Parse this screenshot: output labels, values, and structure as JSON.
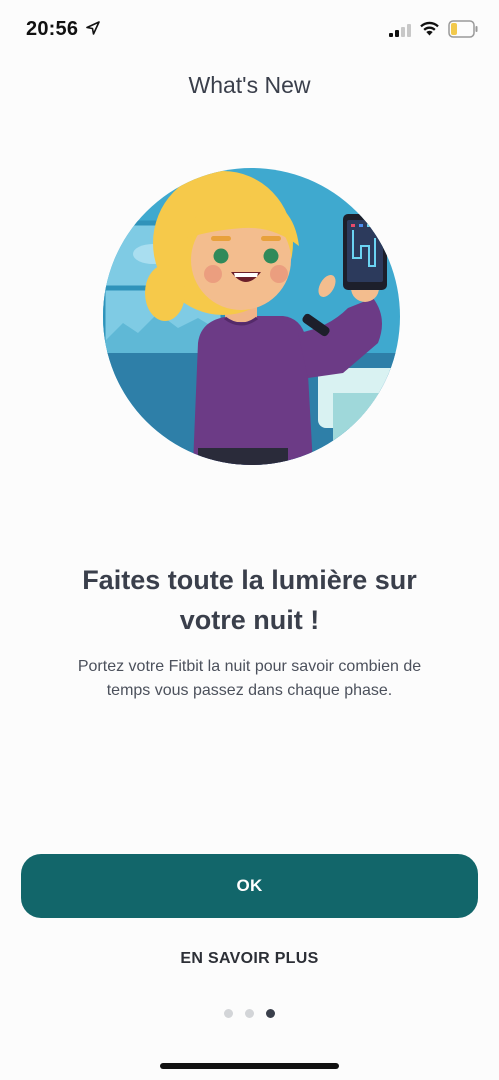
{
  "status_bar": {
    "time": "20:56",
    "icons": [
      "location-arrow-icon",
      "cellular-signal-icon",
      "wifi-icon",
      "battery-low-icon"
    ],
    "battery_color": "#f2c94c"
  },
  "header": {
    "title": "What's New"
  },
  "illustration": {
    "name": "woman-holding-phone-sleep-illustration"
  },
  "content": {
    "headline_line1": "Faites toute la lumière sur",
    "headline_line2": "votre nuit !",
    "description_line1": "Portez votre Fitbit la nuit pour savoir combien de",
    "description_line2": "temps vous passez dans chaque phase."
  },
  "actions": {
    "ok_label": "OK",
    "learn_more_label": "EN SAVOIR PLUS"
  },
  "pagination": {
    "total": 3,
    "current": 3
  },
  "colors": {
    "primary_button": "#12666a",
    "text_dark": "#3a3f4b",
    "dot_inactive": "#d3d5d8",
    "dot_active": "#3a3f4b"
  }
}
